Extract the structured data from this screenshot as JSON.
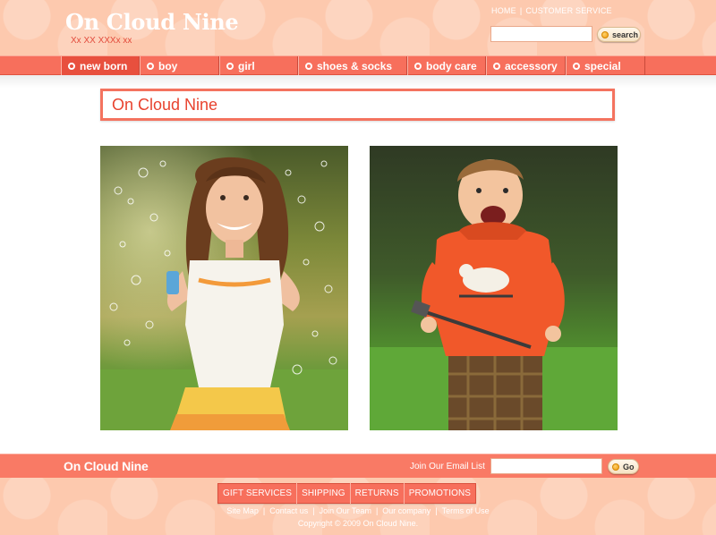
{
  "header": {
    "title": "On Cloud Nine",
    "tagline": "Xx XX XXXx xx",
    "toplinks": [
      "HOME",
      "CUSTOMER SERVICE"
    ],
    "search": {
      "value": "",
      "button_label": "search"
    }
  },
  "nav": {
    "items": [
      {
        "label": "new born",
        "active": true
      },
      {
        "label": "boy"
      },
      {
        "label": "girl"
      },
      {
        "label": "shoes & socks"
      },
      {
        "label": "body care"
      },
      {
        "label": "accessory"
      },
      {
        "label": "special"
      }
    ]
  },
  "main": {
    "title": "On Cloud Nine",
    "photos": [
      {
        "subject": "girl blowing bubbles"
      },
      {
        "subject": "laughing boy in orange hoodie"
      }
    ]
  },
  "footer": {
    "title": "On Cloud Nine",
    "email_label": "Join Our Email List",
    "email": {
      "value": ""
    },
    "go_label": "Go",
    "nav": [
      "GIFT SERVICES",
      "SHIPPING",
      "RETURNS",
      "PROMOTIONS"
    ],
    "links": [
      "Site Map",
      "Contact us",
      "Join Our Team",
      "Our company",
      "Terms of Use"
    ],
    "copyright": "Copyright ©  2009 On Cloud Nine."
  },
  "colors": {
    "accent": "#f76f5c",
    "header_bg": "#fdc9ae",
    "title_text": "#e8432f"
  }
}
